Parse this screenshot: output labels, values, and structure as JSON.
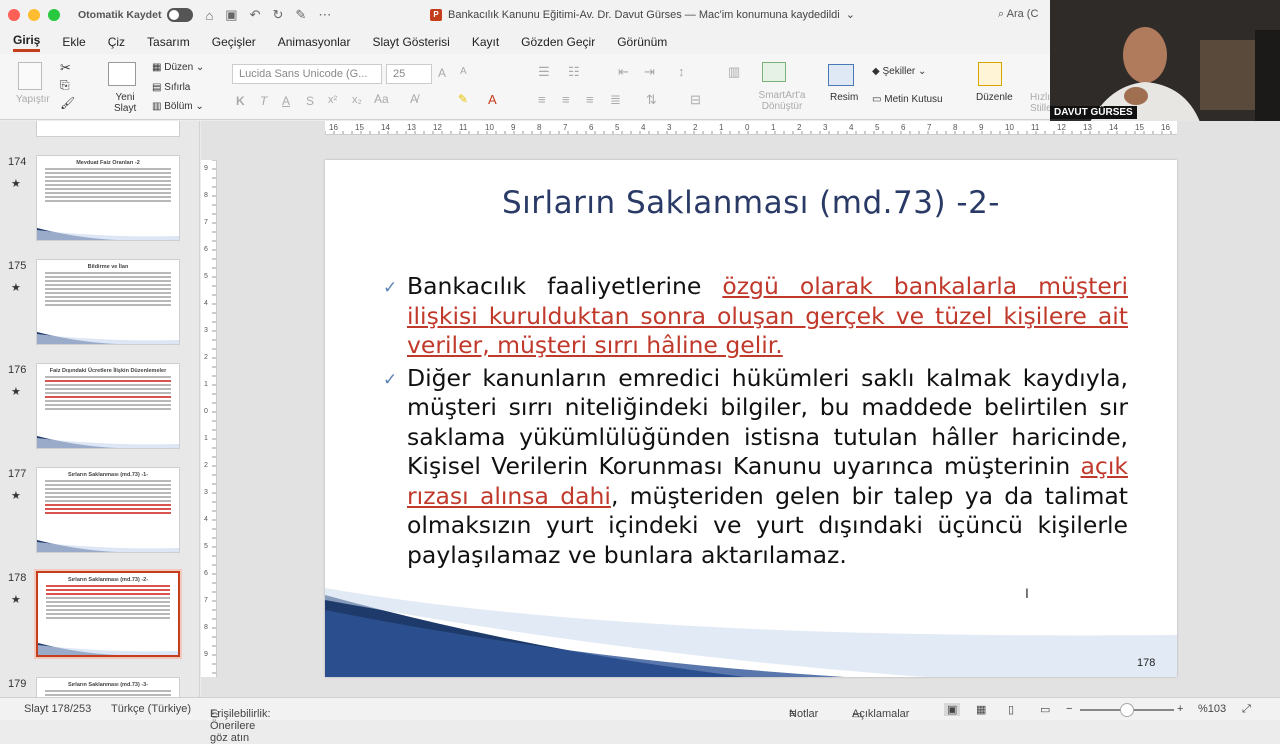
{
  "titlebar": {
    "autosave_label": "Otomatik Kaydet",
    "doc_title": "Bankacılık Kanunu Eğitimi-Av. Dr. Davut Gürses — Mac'im konumuna kaydedildi",
    "search_placeholder": "Ara (C"
  },
  "menu": [
    "Giriş",
    "Ekle",
    "Çiz",
    "Tasarım",
    "Geçişler",
    "Animasyonlar",
    "Slayt Gösterisi",
    "Kayıt",
    "Gözden Geçir",
    "Görünüm"
  ],
  "ribbon": {
    "paste": "Yapıştır",
    "new_slide": "Yeni Slayt",
    "layout": "Düzen",
    "reset": "Sıfırla",
    "section": "Bölüm",
    "font": "Lucida Sans Unicode (G...",
    "size": "25",
    "smartart": "SmartArt'a Dönüştür",
    "picture": "Resim",
    "shapes": "Şekiller",
    "textbox": "Metin Kutusu",
    "arrange": "Düzenle",
    "quick_styles": "Hızlı Stiller"
  },
  "camera": {
    "name": "DAVUT GÜRSES"
  },
  "thumbnails": [
    {
      "num": "174",
      "title": "Mevduat Faiz Oranları -2"
    },
    {
      "num": "175",
      "title": "Bildirme ve İlan"
    },
    {
      "num": "176",
      "title": "Faiz Dışındaki Ücretlere İlişkin Düzenlemeler"
    },
    {
      "num": "177",
      "title": "Sırların Saklanması (md.73) -1-"
    },
    {
      "num": "178",
      "title": "Sırların Saklanması (md.73) -2-"
    },
    {
      "num": "179",
      "title": "Sırların Saklanması (md.73) -3-"
    }
  ],
  "slide": {
    "title": "Sırların Saklanması (md.73) -2-",
    "b1_plain": "Bankacılık faaliyetlerine ",
    "b1_red": "özgü olarak bankalarla müşteri ilişkisi kurulduktan sonra oluşan gerçek ve tüzel kişilere ait veriler, müşteri sırrı hâline gelir.",
    "b2_a": "Diğer kanunların emredici hükümleri saklı kalmak kaydıyla, müşteri sırrı niteliğindeki bilgiler, bu maddede belirtilen sır saklama yükümlülüğünden istisna tutulan hâller haricinde, Kişisel Verilerin Korunması Kanunu uyarınca müşterinin ",
    "b2_red": "açık rızası alınsa dahi",
    "b2_b": ", müşteriden gelen bir talep ya da talimat olmaksızın yurt içindeki ve yurt dışındaki üçüncü kişilerle paylaşılamaz ve bunlara aktarılamaz.",
    "number": "178"
  },
  "status": {
    "slide": "Slayt 178/253",
    "lang": "Türkçe (Türkiye)",
    "access": "Erişilebilirlik: Önerilere göz atın",
    "notes": "Notlar",
    "comments": "Açıklamalar",
    "zoom": "%103"
  },
  "colors": {
    "accent": "#c43e1c",
    "title_blue": "#2a3a66",
    "emphasis_red": "#c0392b"
  }
}
